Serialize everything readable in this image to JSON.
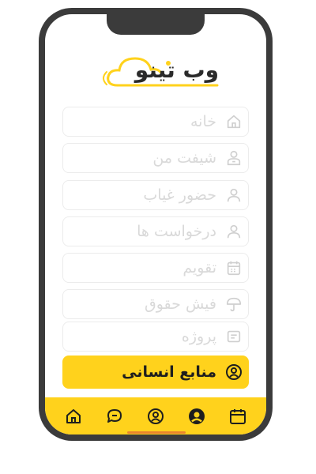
{
  "app": {
    "logo_text": "وب تینو"
  },
  "menu": {
    "items": [
      {
        "label": "خانه",
        "icon": "home-icon"
      },
      {
        "label": "شیفت من",
        "icon": "shift-person-icon"
      },
      {
        "label": "حضور غیاب",
        "icon": "person-icon"
      },
      {
        "label": "درخواست ها",
        "icon": "person-icon"
      },
      {
        "label": "تقویم",
        "icon": "calendar-icon"
      },
      {
        "label": "فیش حقوق",
        "icon": "umbrella-icon"
      },
      {
        "label": "پروژه",
        "icon": "document-icon"
      },
      {
        "label": "منابع انسانی",
        "icon": "person-circle-icon",
        "active": true
      }
    ]
  },
  "bottom_nav": {
    "items": [
      {
        "icon": "calendar-icon"
      },
      {
        "icon": "account-circle-filled-icon"
      },
      {
        "icon": "face-circle-icon"
      },
      {
        "icon": "chat-bubble-icon"
      },
      {
        "icon": "home-icon"
      }
    ]
  },
  "colors": {
    "accent": "#ffd21c",
    "frame": "#3b3b3b",
    "inactive_text": "#d9d9d9",
    "active_text": "#1e1e1e",
    "home_indicator": "#e9852e"
  }
}
